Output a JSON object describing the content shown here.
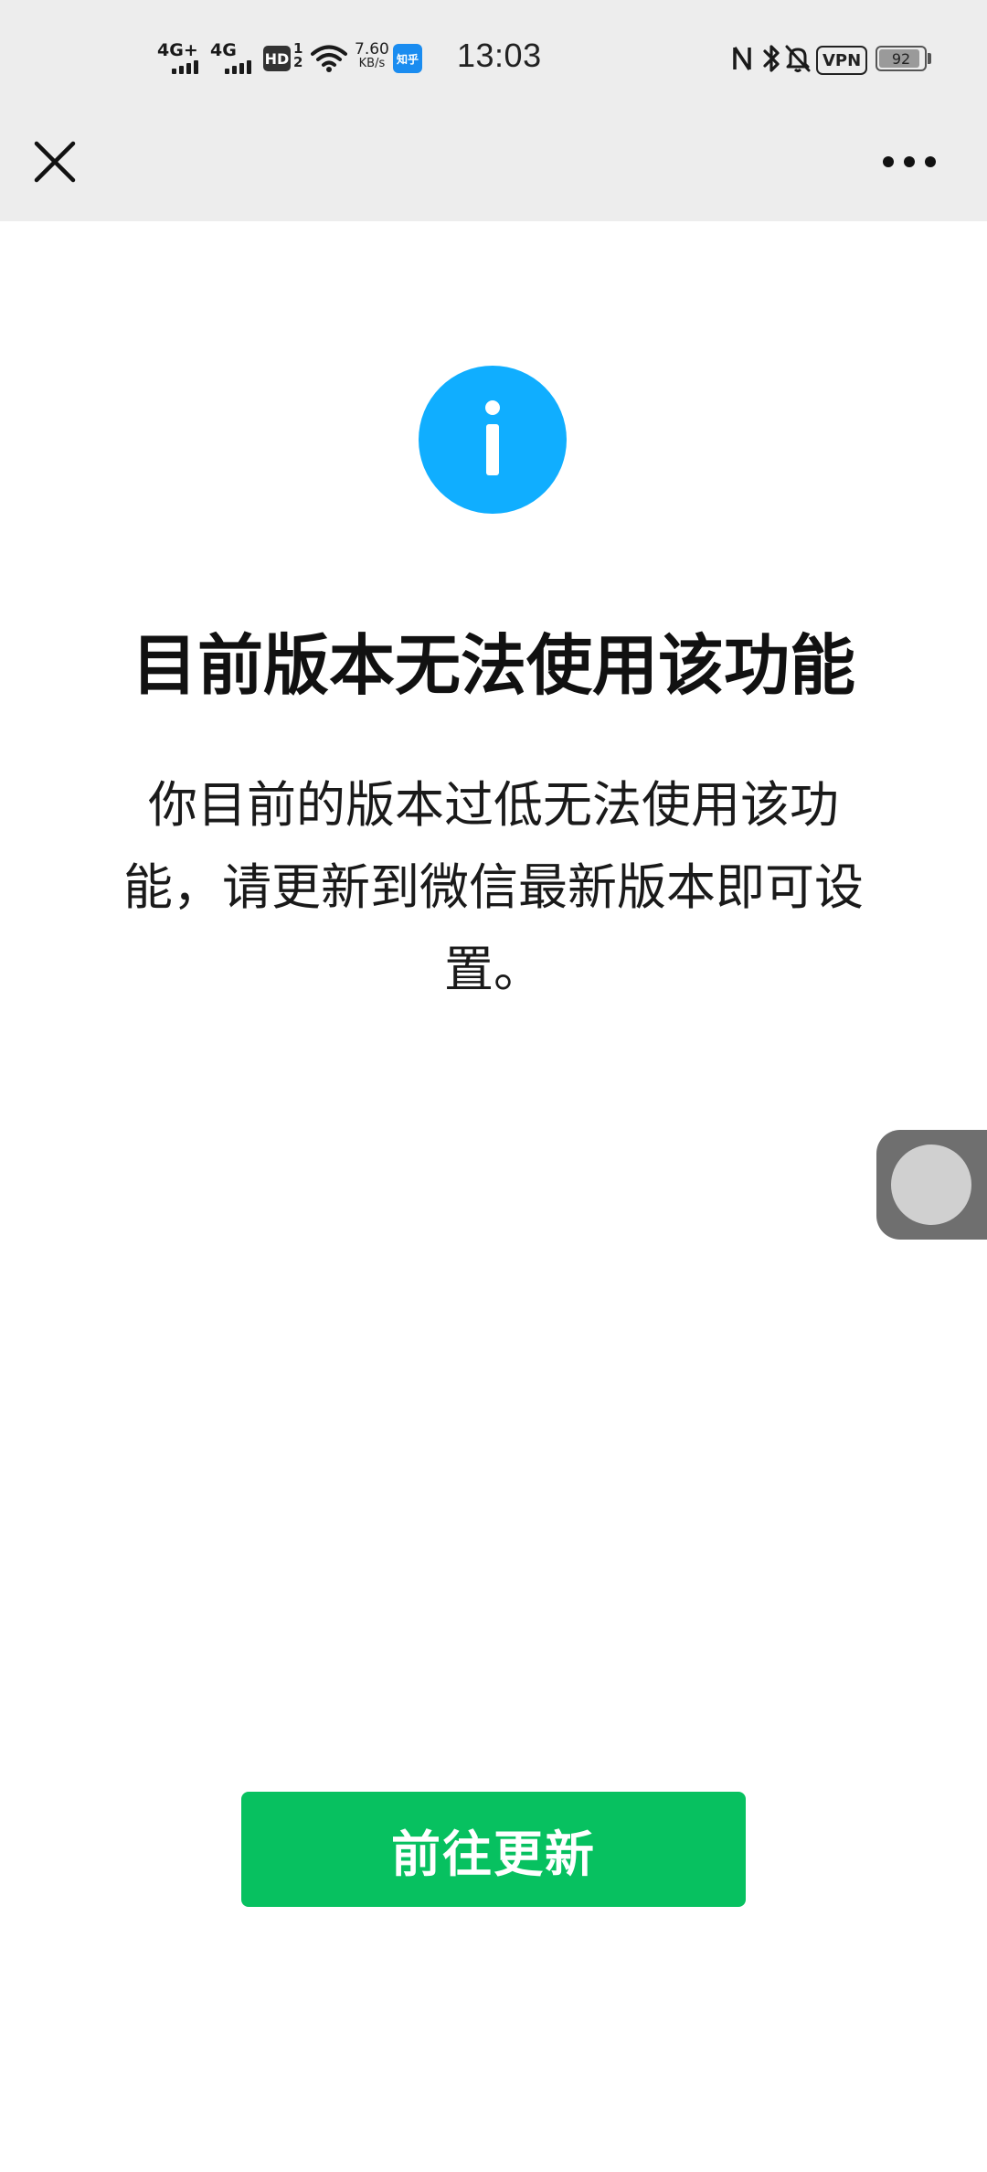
{
  "status_bar": {
    "sim1_network": "4G+",
    "sim2_network": "4G",
    "hd_label": "HD",
    "hd_sims": "1\n2",
    "speed_value": "7.60",
    "speed_unit": "KB/s",
    "app_badge": "知乎",
    "time": "13:03",
    "vpn_label": "VPN",
    "battery_level": "92",
    "icons": [
      "signal-icon",
      "wifi-icon",
      "nfc-icon",
      "bluetooth-icon",
      "mute-icon"
    ]
  },
  "nav": {
    "close_icon": "close-icon",
    "more_icon": "more-icon"
  },
  "content": {
    "icon": "info-icon",
    "accent_color": "#10aeff",
    "title": "目前版本无法使用该功能",
    "description": "你目前的版本过低无法使用该功能，请更新到微信最新版本即可设置。"
  },
  "float_button": {
    "icon": "floating-ball-icon"
  },
  "action": {
    "update_label": "前往更新",
    "button_color": "#07c160"
  }
}
